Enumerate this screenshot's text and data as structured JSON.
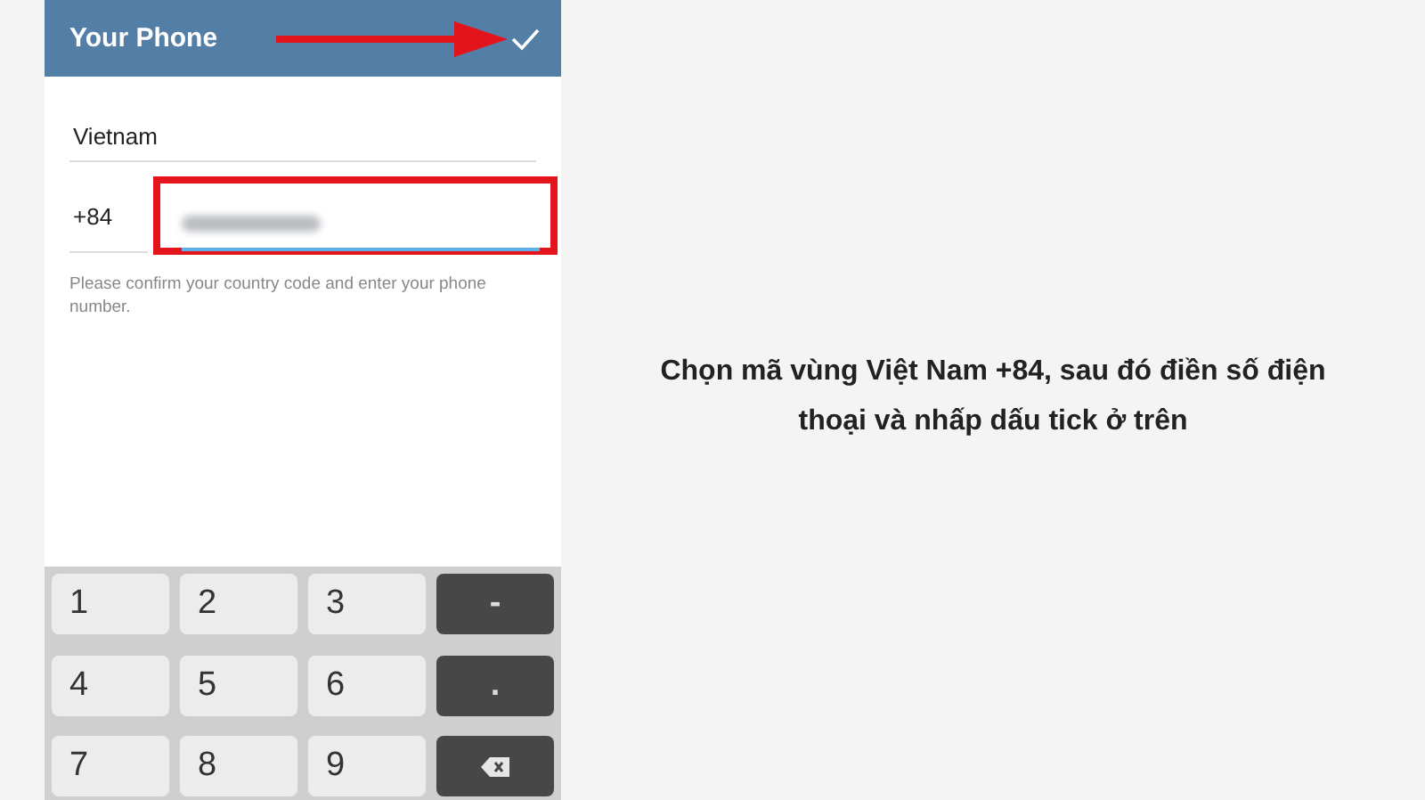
{
  "phone_screen": {
    "header": {
      "title": "Your Phone",
      "pointer_arrow": true
    },
    "country": {
      "value": "Vietnam"
    },
    "phone": {
      "code": "+84",
      "number_blurred": true,
      "highlighted": true
    },
    "hint": "Please confirm your country code and enter your phone number.",
    "keypad": [
      {
        "kind": "digit",
        "label": "1"
      },
      {
        "kind": "digit",
        "label": "2"
      },
      {
        "kind": "digit",
        "label": "3"
      },
      {
        "kind": "symbol",
        "label": "-"
      },
      {
        "kind": "digit",
        "label": "4"
      },
      {
        "kind": "digit",
        "label": "5"
      },
      {
        "kind": "digit",
        "label": "6"
      },
      {
        "kind": "symbol",
        "label": "."
      },
      {
        "kind": "digit",
        "label": "7"
      },
      {
        "kind": "digit",
        "label": "8"
      },
      {
        "kind": "digit",
        "label": "9"
      },
      {
        "kind": "backspace"
      }
    ]
  },
  "caption": "Chọn mã vùng Việt Nam +84, sau đó điền số điện thoại và nhấp dấu tick ở trên"
}
